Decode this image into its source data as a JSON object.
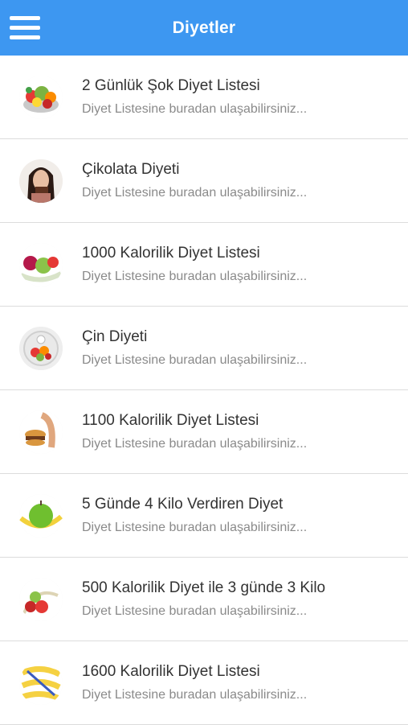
{
  "header": {
    "title": "Diyetler",
    "menu_icon": "hamburger-menu-icon"
  },
  "colors": {
    "appbar": "#3d97f1",
    "divider": "#dcdcdc"
  },
  "items": [
    {
      "title": "2 Günlük Şok Diyet Listesi",
      "subtitle": "Diyet Listesine buradan ulaşabilirsiniz...",
      "icon": "fruit-bowl-image"
    },
    {
      "title": "Çikolata Diyeti",
      "subtitle": "Diyet Listesine buradan ulaşabilirsiniz...",
      "icon": "woman-eating-chocolate-image"
    },
    {
      "title": "1000 Kalorilik Diyet Listesi",
      "subtitle": "Diyet Listesine buradan ulaşabilirsiniz...",
      "icon": "apple-and-measuring-tape-image"
    },
    {
      "title": "Çin Diyeti",
      "subtitle": "Diyet Listesine buradan ulaşabilirsiniz...",
      "icon": "scale-with-vegetables-image"
    },
    {
      "title": "1100 Kalorilik Diyet Listesi",
      "subtitle": "Diyet Listesine buradan ulaşabilirsiniz...",
      "icon": "burger-and-tape-image"
    },
    {
      "title": "5 Günde 4 Kilo Verdiren Diyet",
      "subtitle": "Diyet Listesine buradan ulaşabilirsiniz...",
      "icon": "green-apple-tape-image"
    },
    {
      "title": "500 Kalorilik Diyet ile 3 günde 3 Kilo",
      "subtitle": "Diyet Listesine buradan ulaşabilirsiniz...",
      "icon": "vegetables-tape-image"
    },
    {
      "title": "1600 Kalorilik Diyet Listesi",
      "subtitle": "Diyet Listesine buradan ulaşabilirsiniz...",
      "icon": "measuring-tape-image"
    }
  ]
}
